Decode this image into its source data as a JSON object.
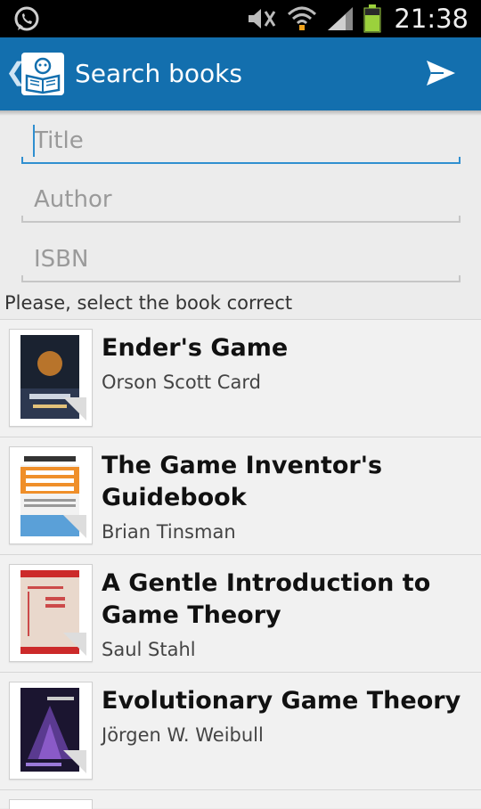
{
  "status": {
    "time": "21:38",
    "icons": [
      "whatsapp-icon",
      "mute-icon",
      "wifi-icon",
      "signal-icon",
      "battery-icon"
    ]
  },
  "actionbar": {
    "title": "Search books",
    "back_glyph": "❮",
    "icons": [
      "app-book-reader-icon",
      "send-icon"
    ]
  },
  "form": {
    "title_placeholder": "Title",
    "author_placeholder": "Author",
    "isbn_placeholder": "ISBN",
    "title_value": "",
    "author_value": "",
    "isbn_value": ""
  },
  "hint": "Please, select the book correct",
  "books": [
    {
      "title": "Ender's Game",
      "author": "Orson Scott Card"
    },
    {
      "title": "The Game Inventor's Guidebook",
      "author": "Brian Tinsman"
    },
    {
      "title": "A Gentle Introduction to Game Theory",
      "author": "Saul Stahl"
    },
    {
      "title": "Evolutionary Game Theory",
      "author": "Jörgen W. Weibull"
    }
  ],
  "colors": {
    "actionbar": "#136fae",
    "accent": "#2f8fd0",
    "background": "#ececec"
  }
}
